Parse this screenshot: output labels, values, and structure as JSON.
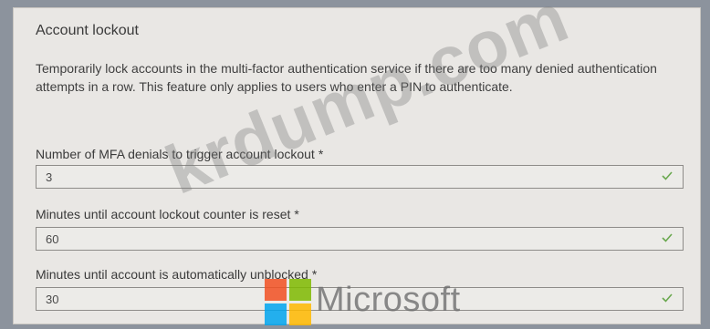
{
  "section": {
    "title": "Account lockout",
    "description": "Temporarily lock accounts in the multi-factor authentication service if there are too many denied authentication attempts in a row. This feature only applies to users who enter a PIN to authenticate."
  },
  "fields": [
    {
      "label": "Number of MFA denials to trigger account lockout",
      "required_mark": "*",
      "value": "3"
    },
    {
      "label": "Minutes until account lockout counter is reset",
      "required_mark": "*",
      "value": "60"
    },
    {
      "label": "Minutes until account is automatically unblocked",
      "required_mark": "*",
      "value": "30"
    }
  ],
  "watermark": {
    "text": "krdump.com",
    "brand_text": "Microsoft"
  },
  "colors": {
    "logo_red": "#f25022",
    "logo_green": "#7fba00",
    "logo_blue": "#00a4ef",
    "logo_yellow": "#ffb900",
    "check_green": "#6aa84f"
  }
}
